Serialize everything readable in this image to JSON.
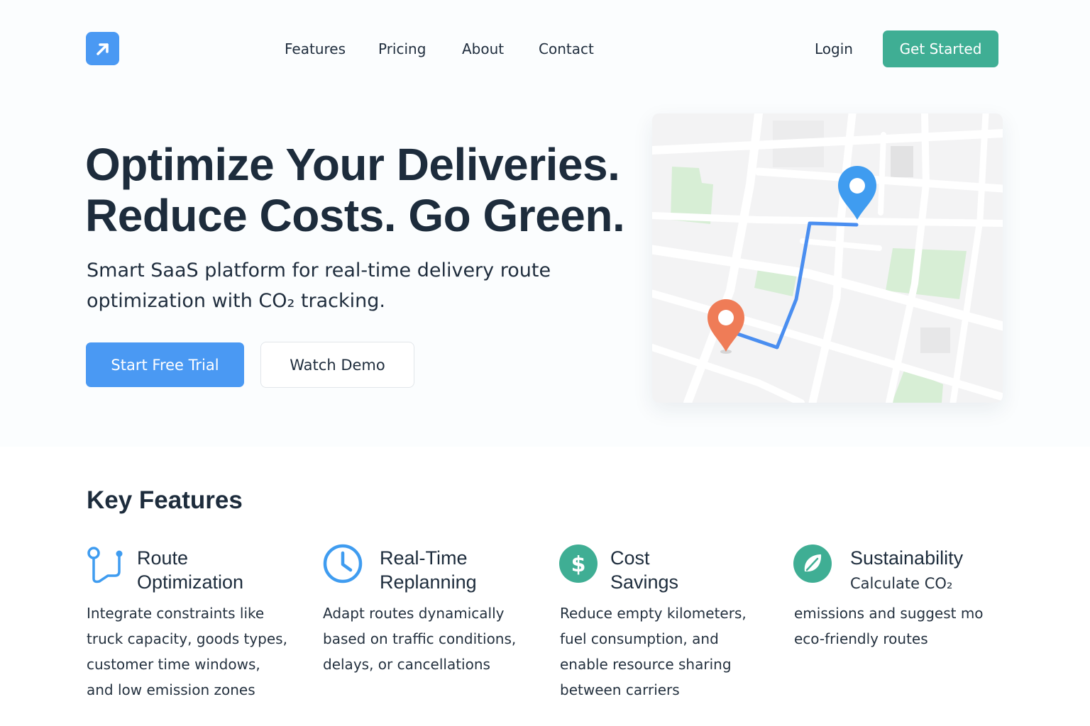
{
  "nav": {
    "links": [
      "Features",
      "Pricing",
      "About",
      "Contact"
    ],
    "login": "Login",
    "cta": "Get Started"
  },
  "hero": {
    "title_lines": [
      "Optimize Your Deliveries.",
      "Reduce Costs. Go Green."
    ],
    "subtitle_lines": [
      "Smart SaaS platform for real-time delivery route",
      "optimization with CO₂ tracking."
    ],
    "primary_button": "Start Free Trial",
    "secondary_button": "Watch Demo"
  },
  "map": {
    "start_marker_color": "#ef7c57",
    "end_marker_color": "#3f9cf0",
    "route_color": "#4a8ef0"
  },
  "features": {
    "title": "Key Features",
    "items": [
      {
        "icon": "route-icon",
        "title_lines": [
          "Route",
          "Optimization"
        ],
        "desc_lines": [
          "Integrate constraints like",
          "truck capacity, goods types,",
          "customer time windows,",
          "and low emission zones"
        ]
      },
      {
        "icon": "clock-icon",
        "title_lines": [
          "Real-Time",
          "Replanning"
        ],
        "desc_lines": [
          "Adapt routes dynamically",
          "based on traffic conditions,",
          "delays, or cancellations"
        ]
      },
      {
        "icon": "dollar-icon",
        "title_lines": [
          "Cost",
          "Savings"
        ],
        "desc_lines": [
          "Reduce empty kilometers,",
          "fuel consumption, and",
          "enable resource sharing",
          "between carriers"
        ]
      },
      {
        "icon": "leaf-icon",
        "title_lines": [
          "Sustainability",
          "Calculate CO₂"
        ],
        "desc_lines": [
          "emissions and suggest mo",
          "eco-friendly routes"
        ]
      }
    ]
  },
  "colors": {
    "brand_blue": "#4a99f3",
    "brand_green": "#3fae94",
    "text_dark": "#1d2c3c"
  }
}
